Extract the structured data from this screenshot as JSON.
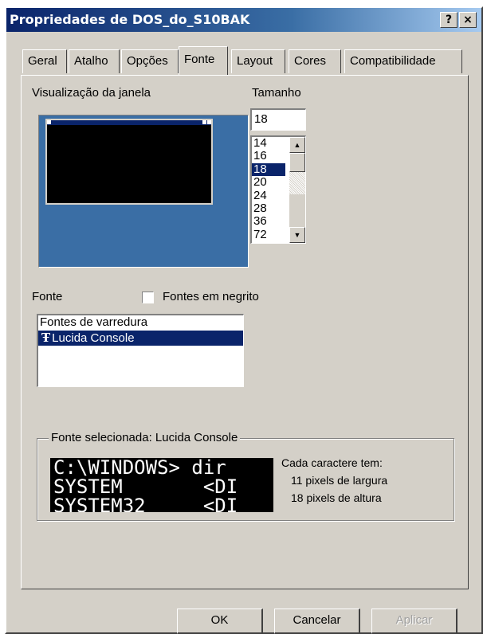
{
  "window": {
    "title": "Propriedades de DOS_do_S10BAK",
    "help_button": "?",
    "close_button": "×"
  },
  "tabs": [
    {
      "label": "Geral"
    },
    {
      "label": "Atalho"
    },
    {
      "label": "Opções"
    },
    {
      "label": "Fonte"
    },
    {
      "label": "Layout"
    },
    {
      "label": "Cores"
    },
    {
      "label": "Compatibilidade"
    }
  ],
  "active_tab": "Fonte",
  "preview": {
    "label": "Visualização da janela"
  },
  "size": {
    "label": "Tamanho",
    "value": "18",
    "options": [
      "14",
      "16",
      "18",
      "20",
      "24",
      "28",
      "36",
      "72"
    ],
    "selected": "18"
  },
  "font": {
    "label": "Fonte",
    "bold_label": "Fontes em negrito",
    "bold_checked": false,
    "options": [
      "Fontes de varredura",
      "Lucida Console"
    ],
    "selected": "Lucida Console",
    "truetype_icon": "truetype-font-icon"
  },
  "selected_font": {
    "legend": "Fonte selecionada: Lucida Console",
    "sample_lines": [
      "C:\\WINDOWS> dir",
      "SYSTEM       <DI",
      "SYSTEM32     <DI"
    ],
    "info_title": "Cada caractere tem:",
    "width_text": "11 pixels de largura",
    "height_text": "18 pixels de altura"
  },
  "buttons": {
    "ok": "OK",
    "cancel": "Cancelar",
    "apply": "Aplicar"
  },
  "colors": {
    "titlebar": "#0a246a",
    "dialog": "#d4d0c8",
    "preview_desktop": "#3a6ea5",
    "selection": "#0a246a"
  }
}
